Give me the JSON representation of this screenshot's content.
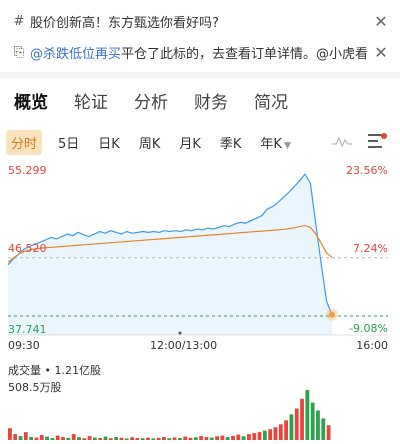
{
  "banners": [
    {
      "lead_icon": "hash-icon",
      "lead_glyph": "#",
      "text": "股价创新高！东方甄选你看好吗?",
      "link": "",
      "close_glyph": "✕"
    },
    {
      "lead_icon": "order-icon",
      "lead_glyph": "⎘",
      "link": "@杀跌低位再买",
      "text": "平仓了此标的，去查看订单详情。@小虎看单",
      "close_glyph": "✕"
    }
  ],
  "tabs": [
    "概览",
    "轮证",
    "分析",
    "财务",
    "简况"
  ],
  "active_tab": 0,
  "periods": [
    "分时",
    "5日",
    "日K",
    "周K",
    "月K",
    "季K",
    "年K"
  ],
  "active_period": 0,
  "price_labels": {
    "high": "55.299",
    "mid": "46.520",
    "low": "37.741"
  },
  "pct_labels": {
    "high": "23.56%",
    "mid": "7.24%",
    "low": "-9.08%"
  },
  "time_labels": [
    "09:30",
    "12:00/13:00",
    "16:00"
  ],
  "volume": {
    "title": "成交量 • 1.21亿股",
    "max": "508.5万股"
  },
  "colors": {
    "up": "#e8453c",
    "down": "#2ba24c",
    "line": "#3b9be8",
    "avg": "#e8862a",
    "accent": "#e0771a"
  },
  "chart_data": {
    "type": "line",
    "x_range": [
      "09:30",
      "16:00"
    ],
    "ylim": [
      37.741,
      55.299
    ],
    "baseline": 44.75,
    "price_series": [
      43.9,
      44.6,
      45.2,
      45.8,
      46.1,
      46.4,
      46.6,
      46.9,
      47.2,
      47.0,
      47.3,
      47.6,
      47.4,
      47.8,
      47.5,
      47.3,
      47.6,
      47.9,
      47.7,
      48.0,
      47.8,
      47.6,
      47.9,
      47.7,
      47.8,
      47.9,
      47.8,
      47.9,
      47.8,
      48.0,
      47.9,
      48.0,
      47.9,
      48.1,
      48.0,
      48.2,
      48.1,
      48.3,
      48.2,
      48.4,
      48.6,
      48.5,
      48.8,
      49.0,
      48.9,
      49.2,
      49.5,
      49.8,
      50.6,
      50.9,
      51.4,
      52.0,
      52.6,
      53.3,
      54.0,
      54.8,
      53.7,
      48.8,
      44.0,
      39.5,
      37.9
    ],
    "avg_series": [
      44.2,
      44.7,
      45.2,
      45.5,
      45.7,
      45.8,
      45.9,
      45.95,
      46.0,
      46.05,
      46.1,
      46.15,
      46.2,
      46.25,
      46.3,
      46.35,
      46.4,
      46.45,
      46.5,
      46.55,
      46.6,
      46.65,
      46.7,
      46.75,
      46.8,
      46.85,
      46.9,
      46.95,
      47.0,
      47.05,
      47.1,
      47.15,
      47.2,
      47.25,
      47.3,
      47.35,
      47.4,
      47.45,
      47.5,
      47.55,
      47.6,
      47.65,
      47.7,
      47.75,
      47.8,
      47.85,
      47.9,
      47.95,
      48.0,
      48.05,
      48.1,
      48.15,
      48.25,
      48.35,
      48.5,
      48.6,
      48.4,
      47.6,
      46.5,
      45.3,
      44.8
    ],
    "volume_max": 508.5,
    "volume_unit": "万股",
    "volume_series": [
      120,
      60,
      40,
      80,
      30,
      25,
      50,
      35,
      20,
      45,
      30,
      22,
      60,
      28,
      18,
      40,
      25,
      20,
      35,
      18,
      30,
      22,
      15,
      28,
      20,
      18,
      24,
      16,
      22,
      30,
      18,
      26,
      20,
      35,
      22,
      28,
      40,
      30,
      25,
      38,
      45,
      30,
      42,
      55,
      38,
      60,
      70,
      80,
      95,
      110,
      130,
      160,
      200,
      260,
      320,
      420,
      508,
      380,
      300,
      220,
      150
    ],
    "volume_up": [
      1,
      1,
      0,
      1,
      0,
      1,
      1,
      0,
      0,
      1,
      1,
      0,
      1,
      0,
      1,
      1,
      0,
      1,
      0,
      1,
      0,
      1,
      0,
      1,
      1,
      0,
      1,
      0,
      1,
      1,
      0,
      1,
      0,
      1,
      1,
      0,
      1,
      1,
      0,
      1,
      1,
      0,
      1,
      1,
      0,
      1,
      1,
      1,
      0,
      1,
      1,
      1,
      1,
      0,
      1,
      1,
      0,
      0,
      0,
      0,
      1
    ]
  }
}
